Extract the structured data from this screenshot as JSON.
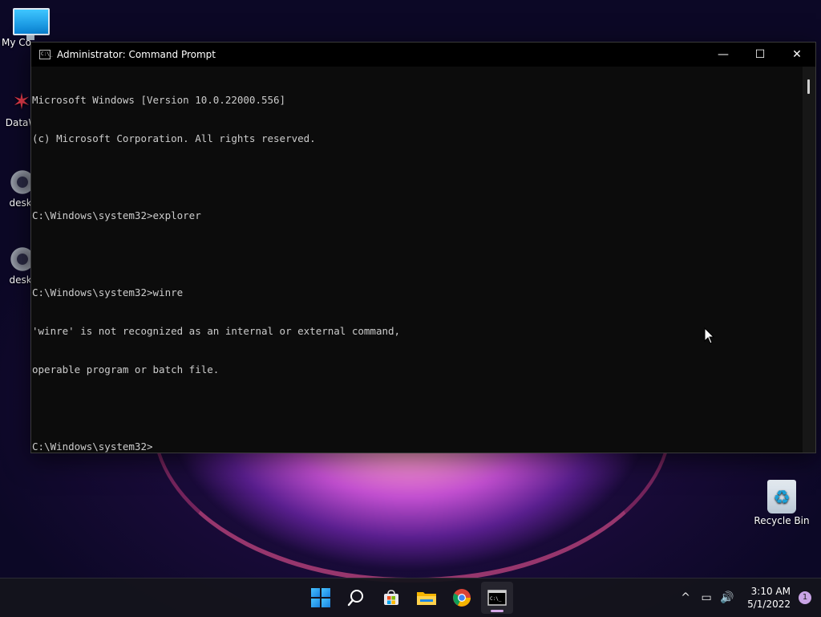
{
  "desktop": {
    "icons": [
      {
        "label": "My Co",
        "icon": "computer-icon"
      },
      {
        "label": "DataW",
        "icon": "datawrapper-icon"
      },
      {
        "label": "deskt",
        "icon": "gear-icon"
      },
      {
        "label": "deskt",
        "icon": "gear-icon"
      },
      {
        "label": "Recycle Bin",
        "icon": "recycle-bin-icon"
      }
    ]
  },
  "window": {
    "title": "Administrator: Command Prompt",
    "app_icon_text": "C:\\_",
    "controls": {
      "minimize": "—",
      "maximize": "☐",
      "close": "✕"
    },
    "lines": [
      "Microsoft Windows [Version 10.0.22000.556]",
      "(c) Microsoft Corporation. All rights reserved.",
      "",
      "C:\\Windows\\system32>explorer",
      "",
      "C:\\Windows\\system32>winre",
      "'winre' is not recognized as an internal or external command,",
      "operable program or batch file.",
      "",
      "C:\\Windows\\system32>"
    ]
  },
  "taskbar": {
    "apps": [
      "start-icon",
      "search-icon",
      "store-icon",
      "file-explorer-icon",
      "chrome-icon",
      "terminal-icon"
    ],
    "tray": {
      "chevron": "^",
      "network": "▭",
      "volume": "🔊"
    },
    "time": "3:10 AM",
    "date": "5/1/2022",
    "notification_count": "1"
  },
  "colors": {
    "terminal_bg": "#0c0c0c",
    "terminal_fg": "#cccccc",
    "taskbar_bg": "#14141c",
    "accent": "#c9a4e6"
  }
}
